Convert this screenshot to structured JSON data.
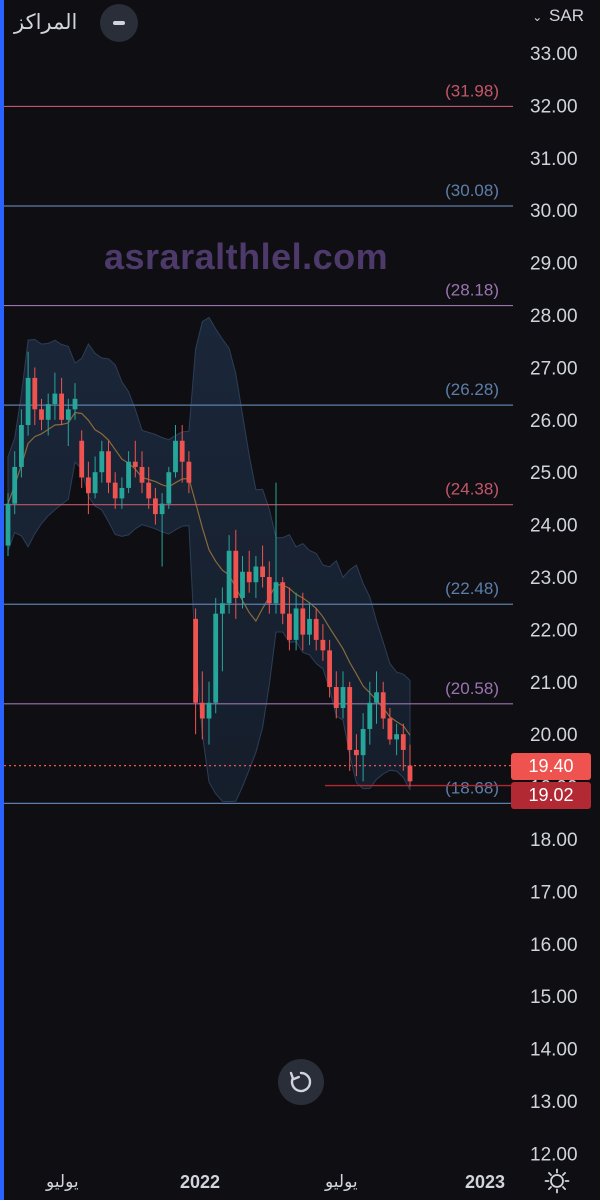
{
  "header": {
    "title": "المراكز",
    "currency": "SAR",
    "currency_chevron_icon": "chevron-down-icon",
    "collapse_icon": "minus-icon"
  },
  "watermark": "asraralthlel.com",
  "price_axis": {
    "labels": [
      "33.00",
      "32.00",
      "31.00",
      "30.00",
      "29.00",
      "28.00",
      "27.00",
      "26.00",
      "25.00",
      "24.00",
      "23.00",
      "22.00",
      "21.00",
      "20.00",
      "19.00",
      "18.00",
      "17.00",
      "16.00",
      "15.00",
      "14.00",
      "13.00",
      "12.00"
    ],
    "current_price": "19.40",
    "low_price": "19.02"
  },
  "levels": [
    {
      "label": "(31.98)",
      "value": 31.98,
      "color": "#c2566a"
    },
    {
      "label": "(30.08)",
      "value": 30.08,
      "color": "#5d7ea8"
    },
    {
      "label": "(28.18)",
      "value": 28.18,
      "color": "#9a74b0"
    },
    {
      "label": "(26.28)",
      "value": 26.28,
      "color": "#5d7ea8"
    },
    {
      "label": "(24.38)",
      "value": 24.38,
      "color": "#c2566a"
    },
    {
      "label": "(22.48)",
      "value": 22.48,
      "color": "#5d7ea8"
    },
    {
      "label": "(20.58)",
      "value": 20.58,
      "color": "#9a74b0"
    },
    {
      "label": "(18.68)",
      "value": 18.68,
      "color": "#5d7ea8"
    }
  ],
  "time_axis": [
    {
      "label": "يوليو",
      "bold": false
    },
    {
      "label": "2022",
      "bold": true
    },
    {
      "label": "يوليو",
      "bold": false
    },
    {
      "label": "2023",
      "bold": true
    }
  ],
  "controls": {
    "reset_icon": "reset-icon",
    "settings_icon": "settings-icon"
  },
  "colors": {
    "up": "#26a69a",
    "down": "#ef5350",
    "background": "#0f0f13",
    "band_fill": "#1b2a3d",
    "band_line": "#2c3e57",
    "ma_line": "#8a6a3a"
  },
  "chart_data": {
    "type": "candlestick",
    "period": "weekly",
    "y_range": [
      12.0,
      33.0
    ],
    "current_price": 19.4,
    "low_marker": 19.02,
    "candles": [
      [
        23.6,
        24.6,
        23.4,
        24.4
      ],
      [
        24.4,
        25.4,
        24.2,
        25.1
      ],
      [
        25.1,
        26.2,
        24.9,
        25.9
      ],
      [
        25.9,
        27.3,
        25.7,
        26.8
      ],
      [
        26.8,
        27.0,
        25.9,
        26.2
      ],
      [
        26.2,
        26.4,
        25.8,
        26.0
      ],
      [
        26.0,
        26.5,
        25.7,
        26.3
      ],
      [
        26.3,
        26.9,
        26.0,
        26.5
      ],
      [
        26.5,
        26.8,
        25.9,
        26.0
      ],
      [
        26.0,
        26.4,
        25.5,
        26.2
      ],
      [
        26.2,
        26.7,
        26.0,
        26.4
      ],
      [
        25.6,
        25.8,
        24.7,
        24.9
      ],
      [
        24.9,
        25.2,
        24.2,
        24.6
      ],
      [
        24.6,
        25.3,
        24.5,
        25.0
      ],
      [
        25.0,
        25.6,
        24.8,
        25.4
      ],
      [
        25.4,
        25.6,
        24.6,
        24.8
      ],
      [
        24.8,
        25.0,
        24.3,
        24.5
      ],
      [
        24.5,
        24.9,
        24.3,
        24.7
      ],
      [
        24.7,
        25.4,
        24.6,
        25.2
      ],
      [
        25.2,
        25.6,
        24.9,
        25.1
      ],
      [
        25.1,
        25.4,
        24.6,
        24.8
      ],
      [
        24.8,
        25.1,
        24.3,
        24.5
      ],
      [
        24.5,
        24.7,
        24.0,
        24.2
      ],
      [
        24.2,
        24.6,
        23.2,
        24.4
      ],
      [
        24.4,
        25.1,
        24.3,
        25.0
      ],
      [
        25.0,
        25.9,
        24.9,
        25.6
      ],
      [
        25.6,
        25.9,
        24.8,
        25.2
      ],
      [
        25.2,
        25.4,
        24.6,
        24.8
      ],
      [
        22.2,
        22.4,
        20.0,
        20.6
      ],
      [
        20.6,
        21.2,
        19.9,
        20.3
      ],
      [
        20.3,
        21.0,
        19.8,
        20.6
      ],
      [
        20.6,
        22.6,
        20.4,
        22.3
      ],
      [
        22.3,
        22.8,
        21.2,
        22.5
      ],
      [
        22.5,
        23.8,
        22.3,
        23.5
      ],
      [
        23.5,
        23.9,
        22.2,
        22.6
      ],
      [
        22.6,
        23.4,
        22.4,
        23.1
      ],
      [
        23.1,
        23.5,
        22.7,
        22.9
      ],
      [
        22.9,
        23.4,
        22.6,
        23.2
      ],
      [
        23.2,
        23.6,
        22.8,
        23.0
      ],
      [
        23.0,
        23.3,
        22.3,
        22.5
      ],
      [
        22.5,
        24.8,
        22.3,
        22.9
      ],
      [
        22.9,
        23.0,
        22.1,
        22.3
      ],
      [
        22.3,
        22.8,
        21.6,
        21.8
      ],
      [
        21.8,
        22.7,
        21.6,
        22.4
      ],
      [
        22.4,
        22.7,
        21.6,
        21.9
      ],
      [
        21.9,
        22.5,
        21.7,
        22.2
      ],
      [
        22.2,
        22.4,
        21.6,
        21.8
      ],
      [
        21.8,
        22.1,
        21.4,
        21.6
      ],
      [
        21.6,
        21.8,
        20.7,
        20.9
      ],
      [
        20.9,
        21.2,
        20.3,
        20.5
      ],
      [
        20.5,
        21.2,
        20.3,
        20.9
      ],
      [
        20.9,
        21.0,
        19.3,
        19.7
      ],
      [
        19.7,
        20.0,
        19.2,
        19.6
      ],
      [
        19.6,
        20.4,
        19.1,
        20.1
      ],
      [
        20.1,
        21.0,
        19.8,
        20.6
      ],
      [
        20.6,
        21.2,
        20.2,
        20.8
      ],
      [
        20.8,
        21.0,
        20.1,
        20.3
      ],
      [
        20.3,
        20.5,
        19.8,
        19.9
      ],
      [
        19.9,
        20.2,
        19.6,
        20.0
      ],
      [
        20.0,
        20.2,
        19.3,
        19.7
      ],
      [
        19.4,
        19.8,
        19.0,
        19.1
      ]
    ]
  }
}
